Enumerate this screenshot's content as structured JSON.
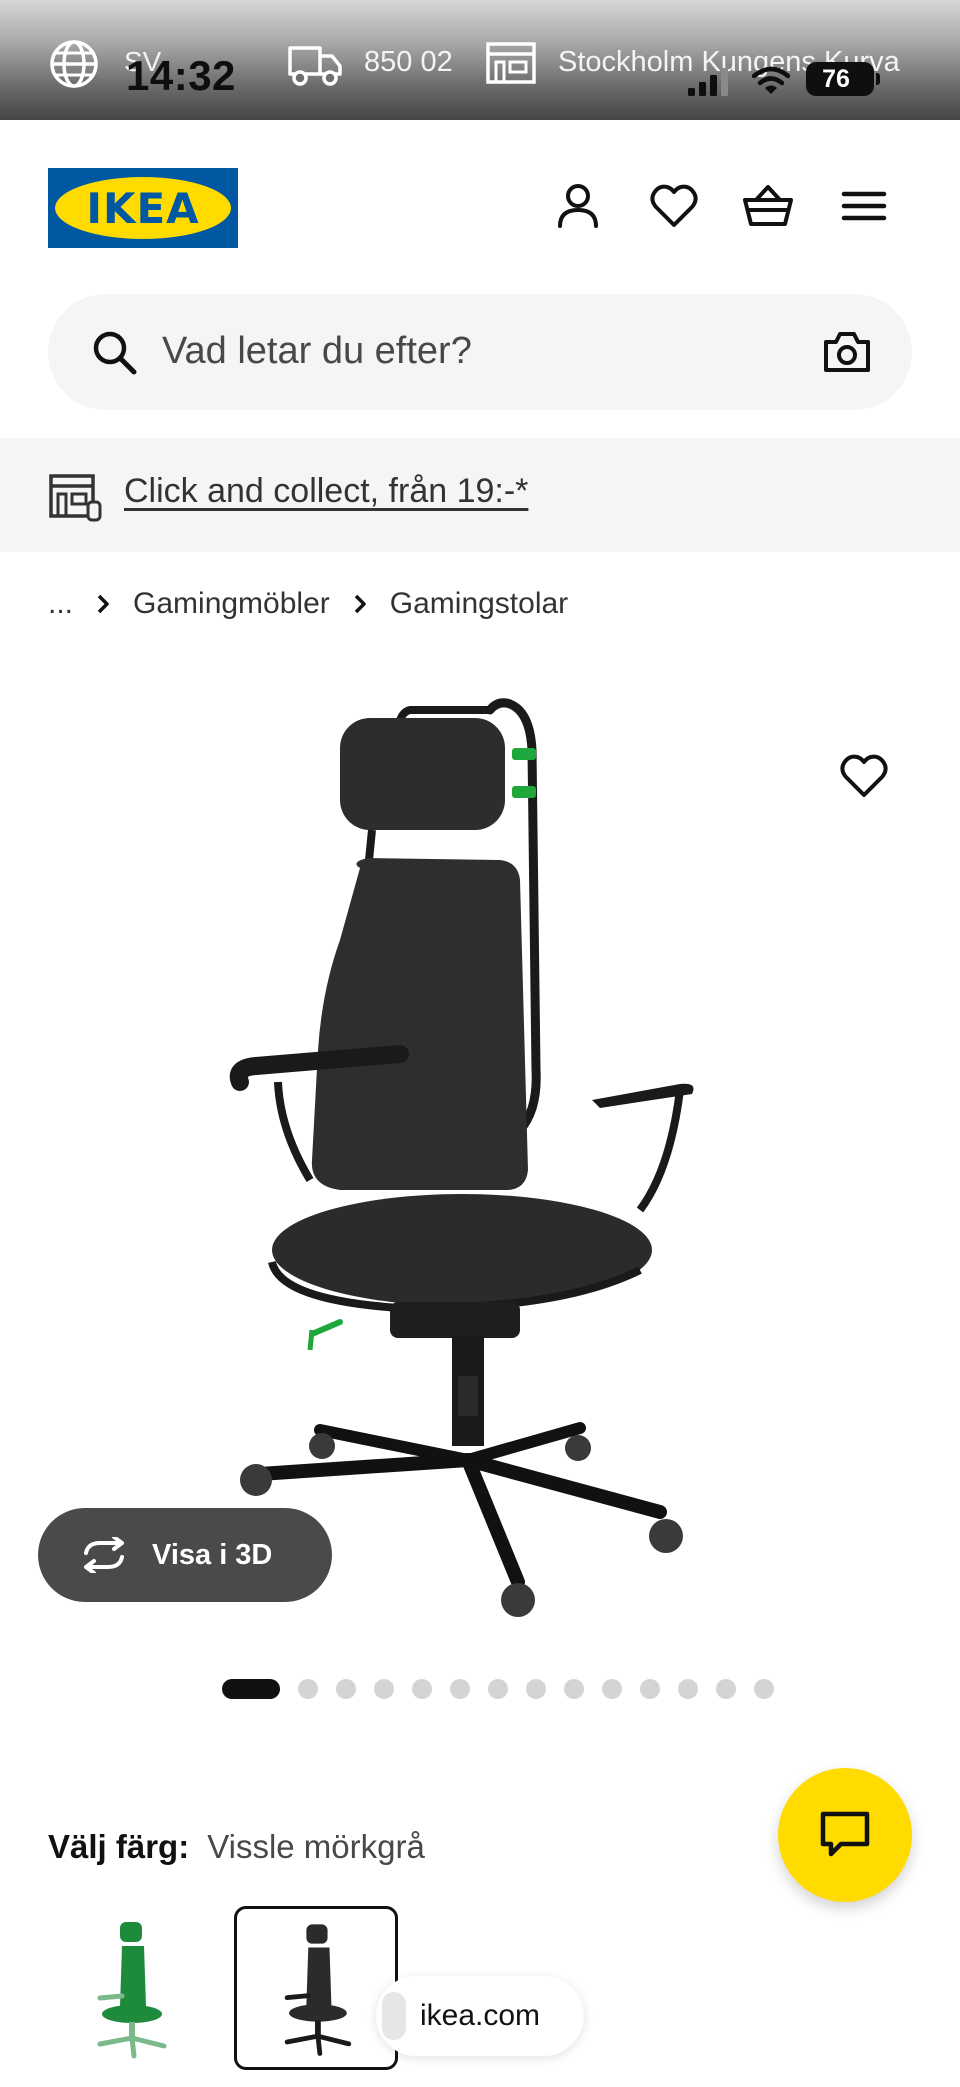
{
  "status_bar": {
    "language": "SV",
    "time": "14:32",
    "postal_code": "850 02",
    "store": "Stockholm Kungens Kurva",
    "battery": "76"
  },
  "header": {
    "logo_text": "IKEA",
    "icons": [
      "person-icon",
      "heart-icon",
      "basket-icon",
      "hamburger-menu-icon"
    ]
  },
  "search": {
    "placeholder": "Vad letar du efter?"
  },
  "click_collect": {
    "text": "Click and collect, från 19:-*"
  },
  "breadcrumb": {
    "items": [
      "...",
      "Gamingmöbler",
      "Gamingstolar"
    ]
  },
  "gallery": {
    "view_3d_label": "Visa i 3D",
    "image_count": 14,
    "active_index": 0
  },
  "color_chooser": {
    "label": "Välj färg:",
    "selected_value": "Vissle mörkgrå",
    "swatches": [
      {
        "name": "green",
        "color": "#1e8a3c",
        "selected": false
      },
      {
        "name": "dark-grey",
        "color": "#2b2b2b",
        "selected": true
      }
    ]
  },
  "browser": {
    "url": "ikea.com"
  },
  "colors": {
    "ikea_blue": "#0058a3",
    "ikea_yellow": "#ffdb00",
    "accent_green": "#1ea83c"
  }
}
